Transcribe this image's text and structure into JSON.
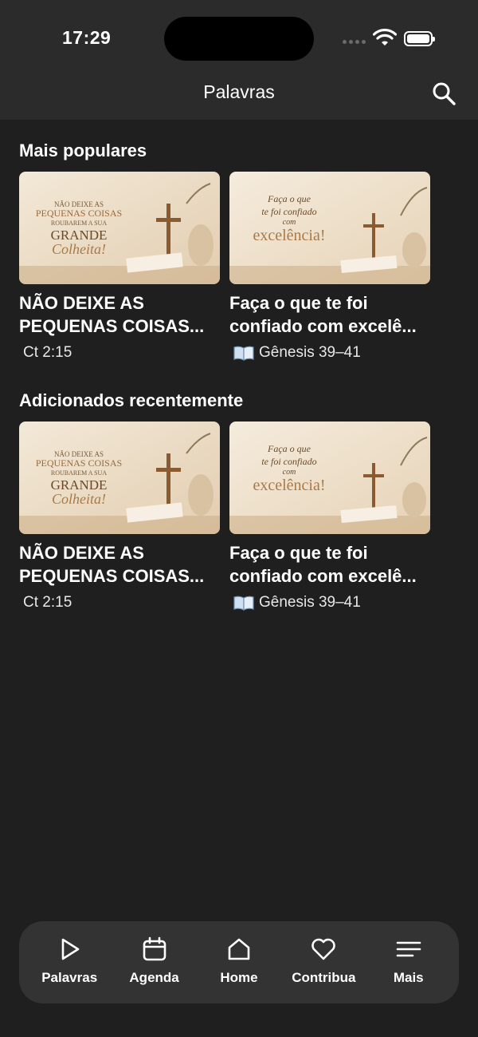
{
  "status_bar": {
    "time": "17:29"
  },
  "header": {
    "title": "Palavras"
  },
  "sections": [
    {
      "title": "Mais populares",
      "cards": [
        {
          "title_lines": [
            "NÃO DEIXE AS",
            "PEQUENAS COISAS..."
          ],
          "reference": "Ct 2:15",
          "thumb_text": [
            "NÃO DEIXE AS",
            "PEQUENAS COISAS",
            "ROUBAREM A SUA",
            "GRANDE",
            "Colheita!"
          ]
        },
        {
          "title_lines": [
            "Faça o que te foi",
            "confiado com excelê..."
          ],
          "reference": "Gênesis 39–41",
          "thumb_text": [
            "Faça o que",
            "te foi confiado",
            "com",
            "excelência!"
          ]
        }
      ]
    },
    {
      "title": "Adicionados recentemente",
      "cards": [
        {
          "title_lines": [
            "NÃO DEIXE AS",
            "PEQUENAS COISAS..."
          ],
          "reference": "Ct 2:15",
          "thumb_text": [
            "NÃO DEIXE AS",
            "PEQUENAS COISAS",
            "ROUBAREM A SUA",
            "GRANDE",
            "Colheita!"
          ]
        },
        {
          "title_lines": [
            "Faça o que te foi",
            "confiado com excelê..."
          ],
          "reference": "Gênesis 39–41",
          "thumb_text": [
            "Faça o que",
            "te foi confiado",
            "com",
            "excelência!"
          ]
        }
      ]
    }
  ],
  "tabbar": [
    {
      "label": "Palavras",
      "icon": "play-icon"
    },
    {
      "label": "Agenda",
      "icon": "calendar-icon"
    },
    {
      "label": "Home",
      "icon": "home-icon"
    },
    {
      "label": "Contribua",
      "icon": "heart-icon"
    },
    {
      "label": "Mais",
      "icon": "menu-icon"
    }
  ],
  "colors": {
    "background": "#1f1f1f",
    "header": "#2b2b2b",
    "tabbar": "#333333",
    "thumb_beige": "#efe3cf",
    "thumb_accent": "#9a6a3c"
  }
}
